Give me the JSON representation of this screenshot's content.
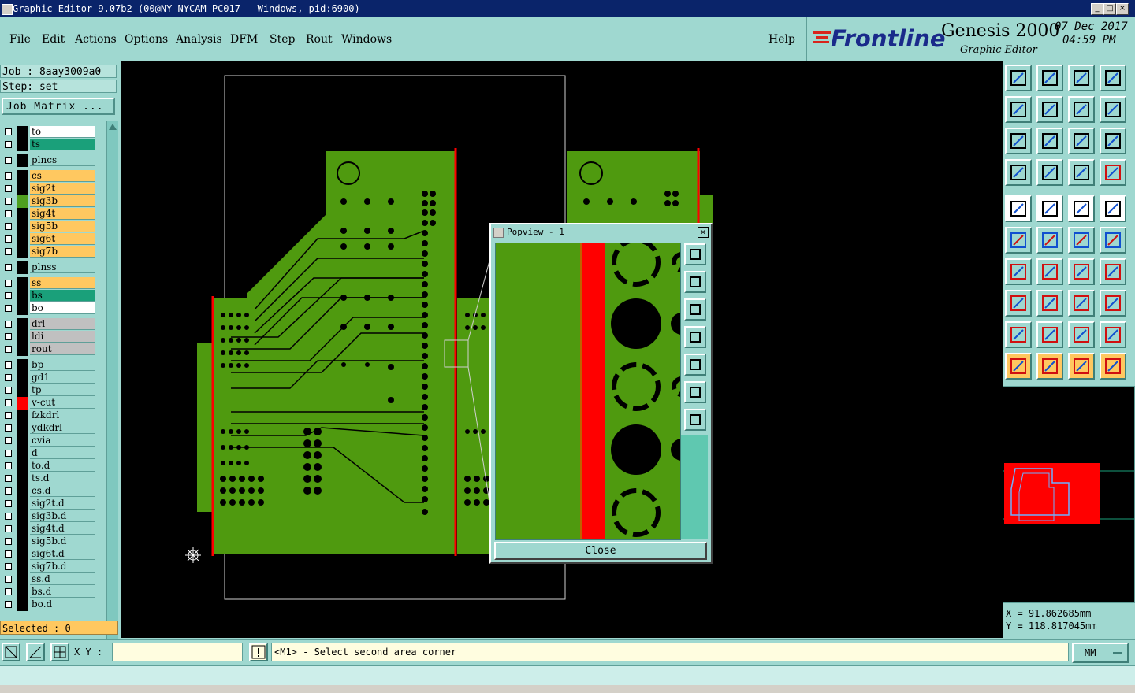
{
  "window": {
    "title": "Graphic Editor 9.07b2 (00@NY-NYCAM-PC017 - Windows, pid:6900)",
    "minimize": "_",
    "maximize": "□",
    "close": "×"
  },
  "menu": {
    "items": [
      "File",
      "Edit",
      "Actions",
      "Options",
      "Analysis",
      "DFM",
      "Step",
      "Rout",
      "Windows"
    ],
    "help": "Help"
  },
  "brand": {
    "logo": "Frontline",
    "product": "Genesis 2000",
    "subtitle": "Graphic Editor",
    "date": "07 Dec 2017",
    "time": "04:59 PM"
  },
  "job": {
    "job_line": "Job : 8aay3009a0",
    "step_line": "Step: set",
    "job_matrix": "Job Matrix ..."
  },
  "layers": [
    {
      "name": "to",
      "color": "#ffffff",
      "swatch": "#000000"
    },
    {
      "name": "ts",
      "color": "#1aa07a",
      "swatch": "#000000"
    },
    {
      "name": "plncs",
      "color": "#9fd8d0",
      "swatch": "#000000"
    },
    {
      "name": "cs",
      "color": "#ffc860",
      "swatch": "#000000"
    },
    {
      "name": "sig2t",
      "color": "#ffc860",
      "swatch": "#000000"
    },
    {
      "name": "sig3b",
      "color": "#ffc860",
      "swatch": "#4fa020"
    },
    {
      "name": "sig4t",
      "color": "#ffc860",
      "swatch": "#000000"
    },
    {
      "name": "sig5b",
      "color": "#ffc860",
      "swatch": "#000000"
    },
    {
      "name": "sig6t",
      "color": "#ffc860",
      "swatch": "#000000"
    },
    {
      "name": "sig7b",
      "color": "#ffc860",
      "swatch": "#000000"
    },
    {
      "name": "plnss",
      "color": "#9fd8d0",
      "swatch": "#000000"
    },
    {
      "name": "ss",
      "color": "#ffc860",
      "swatch": "#000000"
    },
    {
      "name": "bs",
      "color": "#1aa07a",
      "swatch": "#000000"
    },
    {
      "name": "bo",
      "color": "#ffffff",
      "swatch": "#000000"
    },
    {
      "name": "drl",
      "color": "#c0c0c0",
      "swatch": "#000000"
    },
    {
      "name": "ldi",
      "color": "#c0c0c0",
      "swatch": "#000000"
    },
    {
      "name": "rout",
      "color": "#c0c0c0",
      "swatch": "#000000"
    },
    {
      "name": "bp",
      "color": "#9fd8d0",
      "swatch": "#000000"
    },
    {
      "name": "gd1",
      "color": "#9fd8d0",
      "swatch": "#000000"
    },
    {
      "name": "tp",
      "color": "#9fd8d0",
      "swatch": "#000000"
    },
    {
      "name": "v-cut",
      "color": "#9fd8d0",
      "swatch": "#ff0000"
    },
    {
      "name": "fzkdrl",
      "color": "#9fd8d0",
      "swatch": "#000000"
    },
    {
      "name": "ydkdrl",
      "color": "#9fd8d0",
      "swatch": "#000000"
    },
    {
      "name": "cvia",
      "color": "#9fd8d0",
      "swatch": "#000000"
    },
    {
      "name": "d",
      "color": "#9fd8d0",
      "swatch": "#000000"
    },
    {
      "name": "to.d",
      "color": "#9fd8d0",
      "swatch": "#000000"
    },
    {
      "name": "ts.d",
      "color": "#9fd8d0",
      "swatch": "#000000"
    },
    {
      "name": "cs.d",
      "color": "#9fd8d0",
      "swatch": "#000000"
    },
    {
      "name": "sig2t.d",
      "color": "#9fd8d0",
      "swatch": "#000000"
    },
    {
      "name": "sig3b.d",
      "color": "#9fd8d0",
      "swatch": "#000000"
    },
    {
      "name": "sig4t.d",
      "color": "#9fd8d0",
      "swatch": "#000000"
    },
    {
      "name": "sig5b.d",
      "color": "#9fd8d0",
      "swatch": "#000000"
    },
    {
      "name": "sig6t.d",
      "color": "#9fd8d0",
      "swatch": "#000000"
    },
    {
      "name": "sig7b.d",
      "color": "#9fd8d0",
      "swatch": "#000000"
    },
    {
      "name": "ss.d",
      "color": "#9fd8d0",
      "swatch": "#000000"
    },
    {
      "name": "bs.d",
      "color": "#9fd8d0",
      "swatch": "#000000"
    },
    {
      "name": "bo.d",
      "color": "#9fd8d0",
      "swatch": "#000000"
    }
  ],
  "selected": "Selected : 0",
  "coords": {
    "x": "X = 91.862685mm",
    "y": "Y = 118.817045mm"
  },
  "bottom": {
    "xy_label": "X Y :",
    "xy_value": "",
    "prompt": "<M1> - Select second area corner",
    "units": "MM"
  },
  "popview": {
    "title": "Popview - 1",
    "close": "Close"
  },
  "colors": {
    "board_green": "#4f9a0f",
    "vcut_red": "#ff0000",
    "panel_bg": "#9fd8d0"
  }
}
